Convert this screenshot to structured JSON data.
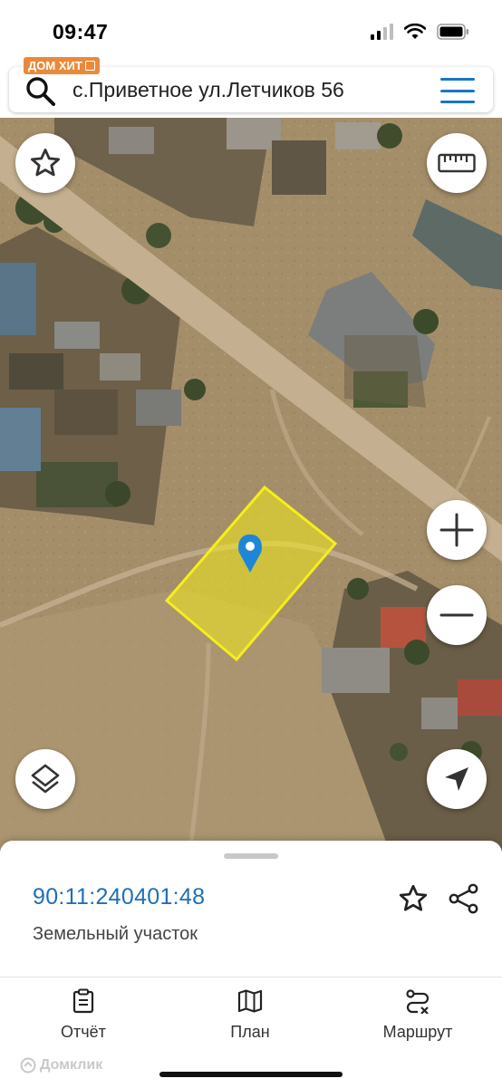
{
  "status_bar": {
    "time": "09:47"
  },
  "header": {
    "brand_badge": "ДОМ ХИТ",
    "search_value": "с.Приветное ул.Летчиков 56"
  },
  "map": {
    "controls": [
      "favorite-location",
      "ruler",
      "zoom-in",
      "zoom-out",
      "layers",
      "my-location"
    ],
    "plot_color": "#f2ea1a",
    "pin_color": "#1e86d6"
  },
  "sheet": {
    "cadastral_number": "90:11:240401:48",
    "object_type": "Земельный участок"
  },
  "tabs": [
    {
      "label": "Отчёт",
      "icon": "report-clipboard-icon"
    },
    {
      "label": "План",
      "icon": "map-plan-icon"
    },
    {
      "label": "Маршрут",
      "icon": "route-icon"
    }
  ],
  "watermark": "Домклик",
  "colors": {
    "accent": "#1e6fb8",
    "menu": "#1877c4",
    "badge": "#e98a3a"
  }
}
